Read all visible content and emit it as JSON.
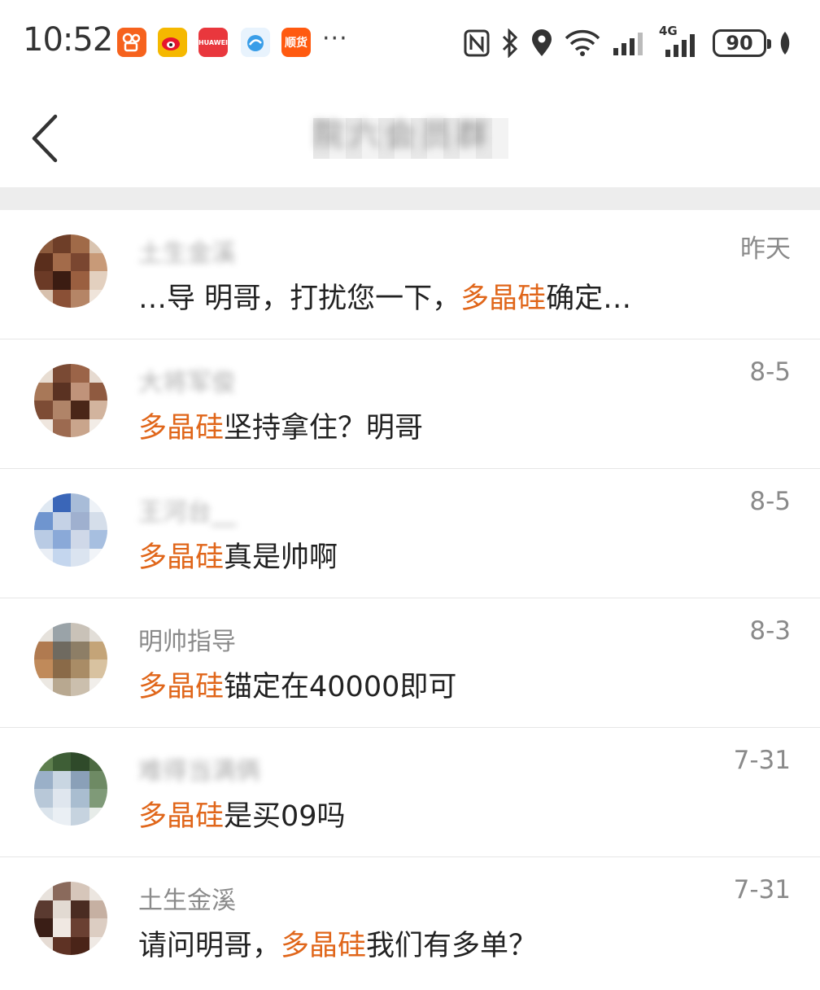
{
  "status_bar": {
    "time": "10:52",
    "apps": [
      {
        "name": "kuaishou-icon",
        "label": "",
        "color": "#f6621d"
      },
      {
        "name": "weibo-icon",
        "label": "",
        "color": "#f5b800"
      },
      {
        "name": "huawei-store-icon",
        "label": "HUAWEI",
        "color": "#e9373d"
      },
      {
        "name": "bird-app-icon",
        "label": "",
        "color": "#3a9ee8"
      },
      {
        "name": "shunhuo-icon",
        "label": "顺货",
        "color": "#ff5a10"
      }
    ],
    "more": "···",
    "network": "4G",
    "battery": "90"
  },
  "nav": {
    "title": "院六会员群",
    "back_icon": "chevron-left-icon"
  },
  "colors": {
    "highlight": "#e0661a",
    "secondary_text": "#8a8a8a"
  },
  "conversations": [
    {
      "sender": "土生金溪",
      "sender_blurred": true,
      "date": "昨天",
      "message_before": "…导 明哥，打扰您一下，",
      "keyword": "多晶硅",
      "message_after": "确定…"
    },
    {
      "sender": "大将军俊",
      "sender_blurred": true,
      "date": "8-5",
      "message_before": "",
      "keyword": "多晶硅",
      "message_after": "坚持拿住？明哥"
    },
    {
      "sender": "王河台__",
      "sender_blurred": true,
      "date": "8-5",
      "message_before": "",
      "keyword": "多晶硅",
      "message_after": "真是帅啊"
    },
    {
      "sender": "明帅指导",
      "sender_blurred": false,
      "date": "8-3",
      "message_before": "",
      "keyword": "多晶硅",
      "message_after": "锚定在40000即可"
    },
    {
      "sender": "难得当满俩",
      "sender_blurred": true,
      "date": "7-31",
      "message_before": "",
      "keyword": "多晶硅",
      "message_after": "是买09吗"
    },
    {
      "sender": "土生金溪",
      "sender_blurred": false,
      "date": "7-31",
      "message_before": "请问明哥，",
      "keyword": "多晶硅",
      "message_after": "我们有多单？"
    }
  ]
}
